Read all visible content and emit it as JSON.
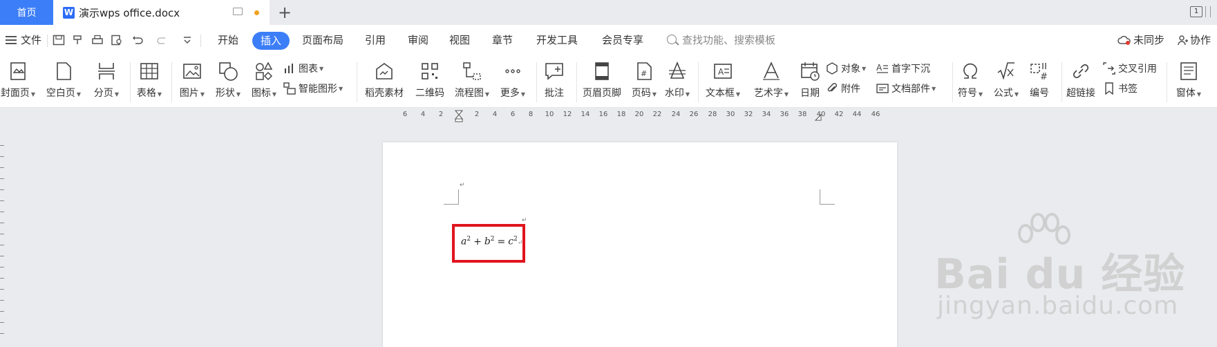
{
  "tabs": {
    "home": "首页",
    "document": "演示wps office.docx"
  },
  "menu": {
    "file": "文件",
    "items": [
      "开始",
      "插入",
      "页面布局",
      "引用",
      "审阅",
      "视图",
      "章节",
      "开发工具",
      "会员专享"
    ],
    "active": "插入",
    "search_placeholder": "查找功能、搜索模板",
    "sync": "未同步",
    "collab": "协作"
  },
  "ribbon": {
    "cover": "封面页",
    "blank": "空白页",
    "break": "分页",
    "table": "表格",
    "picture": "图片",
    "shape": "形状",
    "icon": "图标",
    "chart": "图表",
    "smartart": "智能图形",
    "docer": "稻壳素材",
    "qrcode": "二维码",
    "flowchart": "流程图",
    "more": "更多",
    "comment": "批注",
    "header_footer": "页眉页脚",
    "page_number": "页码",
    "watermark": "水印",
    "textbox": "文本框",
    "wordart": "艺术字",
    "date": "日期",
    "object": "对象",
    "attachment": "附件",
    "dropcap": "首字下沉",
    "doc_parts": "文档部件",
    "symbol": "符号",
    "equation": "公式",
    "numbering": "编号",
    "hyperlink": "超链接",
    "crossref": "交叉引用",
    "bookmark": "书签",
    "form": "窗体"
  },
  "ruler": [
    "6",
    "4",
    "2",
    "2",
    "4",
    "6",
    "8",
    "10",
    "12",
    "14",
    "16",
    "18",
    "20",
    "22",
    "24",
    "26",
    "28",
    "30",
    "32",
    "34",
    "36",
    "38",
    "40",
    "42",
    "44",
    "46"
  ],
  "document": {
    "formula_a": "a",
    "formula_b": "b",
    "formula_c": "c",
    "exp": "2",
    "plus": "+",
    "equals": "="
  },
  "watermark": {
    "main": "Bai du 经验",
    "sub": "jingyan.baidu.com"
  },
  "colors": {
    "accent": "#3c7ef7",
    "highlight": "#e0141e"
  }
}
